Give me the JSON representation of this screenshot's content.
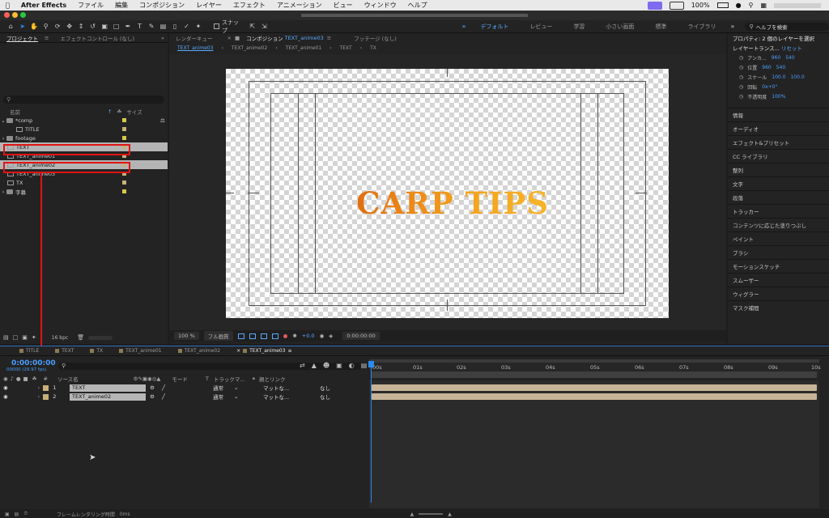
{
  "menubar": {
    "app": "After Effects",
    "items": [
      "ファイル",
      "編集",
      "コンポジション",
      "レイヤー",
      "エフェクト",
      "アニメーション",
      "ビュー",
      "ウィンドウ",
      "ヘルプ"
    ],
    "battery": "100%"
  },
  "toolbar": {
    "snap_label": "スナップ",
    "workspaces": [
      "デフォルト",
      "レビュー",
      "学習",
      "小さい画面",
      "標準",
      "ライブラリ"
    ],
    "help_placeholder": "ヘルプを検索"
  },
  "project": {
    "tabs": [
      "プロジェクト",
      "エフェクトコントロール (なし)"
    ],
    "headers": {
      "name": "名前",
      "type": "サイズ"
    },
    "items": [
      {
        "label": "*comp",
        "kind": "folder",
        "color": "#d8c84a"
      },
      {
        "label": "TITLE",
        "kind": "comp",
        "color": "#c9b07a"
      },
      {
        "label": "footage",
        "kind": "folder",
        "color": "#d8c84a"
      },
      {
        "label": "TEXT",
        "kind": "comp",
        "color": "#c9b07a"
      },
      {
        "label": "TEXT_anime01",
        "kind": "comp",
        "color": "#c9b07a"
      },
      {
        "label": "TEXT_anime02",
        "kind": "comp",
        "color": "#c9b07a"
      },
      {
        "label": "TEXT_anime03",
        "kind": "comp",
        "color": "#c9b07a"
      },
      {
        "label": "TX",
        "kind": "comp",
        "color": "#c9b07a"
      },
      {
        "label": "字幕",
        "kind": "folder",
        "color": "#d8c84a"
      }
    ],
    "bpc": "16 bpc"
  },
  "composition": {
    "tabs": [
      "レンダーキュー",
      "コンポジション",
      "TEXT_anime03",
      "フッテージ (なし)"
    ],
    "breadcrumbs": [
      "TEXT_anime03",
      "TEXT_anime02",
      "TEXT_anime01",
      "TEXT",
      "TX"
    ],
    "title_text": "CARP TIPS",
    "zoom": "100 %",
    "quality": "フル画質",
    "exposure": "+0.0",
    "time": "0:00:00:00"
  },
  "right": {
    "props_title": "プロパティ: 2 個のレイヤーを選択",
    "transform_label": "レイヤートランス...",
    "reset": "リセット",
    "properties": [
      {
        "label": "アンカ...",
        "v1": "960",
        "v2": "540"
      },
      {
        "label": "位置",
        "v1": "960",
        "v2": "540"
      },
      {
        "label": "スケール",
        "v1": "100.0",
        "v2": "100.0"
      },
      {
        "label": "回転",
        "v1": "0x+0°",
        "v2": ""
      },
      {
        "label": "不透明度",
        "v1": "100%",
        "v2": ""
      }
    ],
    "sections": [
      "情報",
      "オーディオ",
      "エフェクト&プリセット",
      "CC ライブラリ",
      "整列",
      "文字",
      "段落",
      "トラッカー",
      "コンテンツに応じた塗りつぶし",
      "ペイント",
      "ブラシ",
      "モーションスケッチ",
      "スムーザー",
      "ウィグラー",
      "マスク補間"
    ]
  },
  "timeline": {
    "tabs": [
      "TITLE",
      "TEXT",
      "TX",
      "TEXT_anime01",
      "TEXT_anime02",
      "TEXT_anime03"
    ],
    "timecode": "0:00:00:00",
    "subcode": "00000 (29.97 fps)",
    "headers": {
      "source": "ソース名",
      "mode": "モード",
      "t": "T",
      "track": "トラックマ...",
      "parent": "親とリンク"
    },
    "layers": [
      {
        "num": "1",
        "name": "TEXT",
        "mode": "通常",
        "track": "マットな...",
        "parent": "なし"
      },
      {
        "num": "2",
        "name": "TEXT_anime02",
        "mode": "通常",
        "track": "マットな...",
        "parent": "なし"
      }
    ],
    "ruler": [
      "00s",
      "01s",
      "02s",
      "03s",
      "04s",
      "05s",
      "06s",
      "07s",
      "08s",
      "09s",
      "10s"
    ],
    "status": "フレームレンダリング時間",
    "status_value": "0ms"
  },
  "colors": {
    "accent": "#2d8ceb",
    "highlight": "#e01414",
    "layer_bar": "#c7b497"
  }
}
